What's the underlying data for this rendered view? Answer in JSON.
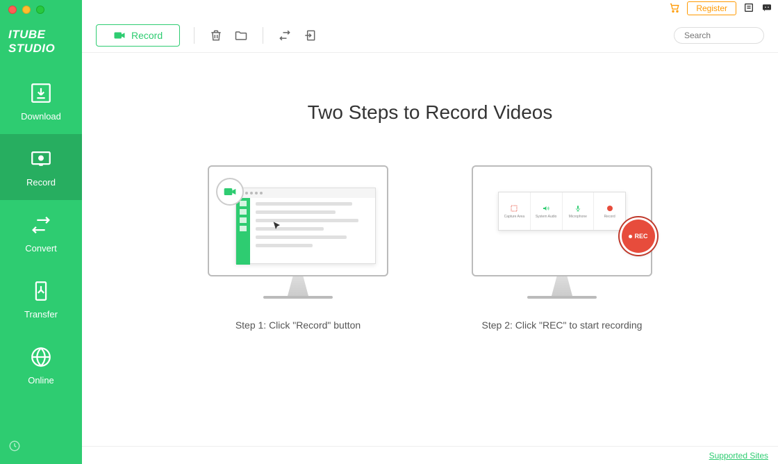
{
  "app": {
    "name": "ITUBE STUDIO"
  },
  "header": {
    "register_label": "Register"
  },
  "toolbar": {
    "record_label": "Record",
    "search_placeholder": "Search"
  },
  "sidebar": {
    "items": [
      {
        "label": "Download"
      },
      {
        "label": "Record"
      },
      {
        "label": "Convert"
      },
      {
        "label": "Transfer"
      },
      {
        "label": "Online"
      }
    ]
  },
  "main": {
    "title": "Two Steps to Record Videos",
    "steps": [
      {
        "label": "Step 1: Click \"Record\" button"
      },
      {
        "label": "Step 2: Click \"REC\" to start recording"
      }
    ],
    "rec_badge": "REC",
    "s2_cells": [
      {
        "label": "Capture Area"
      },
      {
        "label": "System Audio"
      },
      {
        "label": "Microphone"
      },
      {
        "label": "Record"
      }
    ]
  },
  "footer": {
    "supported_sites": "Supported Sites"
  }
}
